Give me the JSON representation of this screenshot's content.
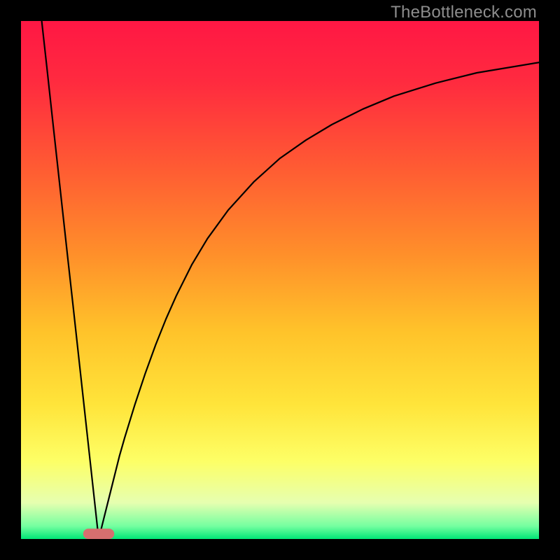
{
  "watermark": "TheBottleneck.com",
  "chart_data": {
    "type": "line",
    "title": "",
    "xlabel": "",
    "ylabel": "",
    "xlim": [
      0,
      100
    ],
    "ylim": [
      0,
      100
    ],
    "grid": false,
    "legend": false,
    "background_gradient_stops": [
      {
        "offset": 0.0,
        "color": "#ff1744"
      },
      {
        "offset": 0.12,
        "color": "#ff2b3f"
      },
      {
        "offset": 0.28,
        "color": "#ff5a33"
      },
      {
        "offset": 0.45,
        "color": "#ff8f2a"
      },
      {
        "offset": 0.6,
        "color": "#ffc32a"
      },
      {
        "offset": 0.74,
        "color": "#ffe43a"
      },
      {
        "offset": 0.85,
        "color": "#fdff66"
      },
      {
        "offset": 0.93,
        "color": "#e6ffb0"
      },
      {
        "offset": 0.975,
        "color": "#75ffa0"
      },
      {
        "offset": 1.0,
        "color": "#00e676"
      }
    ],
    "minimum_x": 15,
    "marker": {
      "x": 15,
      "y": 0,
      "width": 6,
      "height": 2,
      "color": "#d66f6f"
    },
    "series": [
      {
        "name": "left-branch",
        "x": [
          4.0,
          5.0,
          6.0,
          7.0,
          8.0,
          9.0,
          10.0,
          11.0,
          12.0,
          13.0,
          14.0,
          15.0
        ],
        "y": [
          100.0,
          91.0,
          81.8,
          72.7,
          63.6,
          54.5,
          45.5,
          36.4,
          27.3,
          18.2,
          9.1,
          0.0
        ]
      },
      {
        "name": "right-branch",
        "x": [
          15,
          16,
          17,
          18,
          19,
          20,
          22,
          24,
          26,
          28,
          30,
          33,
          36,
          40,
          45,
          50,
          55,
          60,
          66,
          72,
          80,
          88,
          100
        ],
        "y": [
          0.0,
          4.0,
          8.0,
          12.0,
          16.0,
          19.5,
          26.0,
          32.0,
          37.5,
          42.5,
          47.0,
          53.0,
          58.0,
          63.5,
          69.0,
          73.5,
          77.0,
          80.0,
          83.0,
          85.5,
          88.0,
          90.0,
          92.0
        ]
      }
    ]
  }
}
